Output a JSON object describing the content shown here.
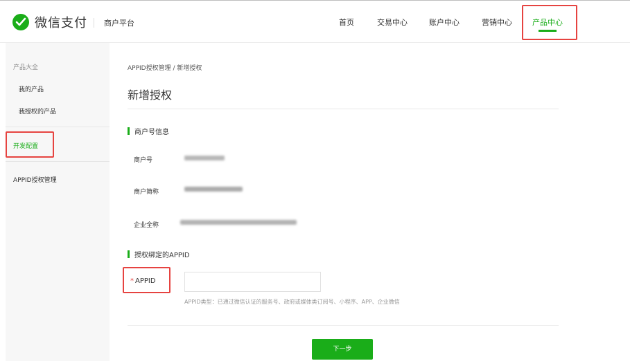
{
  "header": {
    "brand": "微信支付",
    "platform": "商户平台",
    "nav": [
      {
        "label": "首页"
      },
      {
        "label": "交易中心"
      },
      {
        "label": "账户中心"
      },
      {
        "label": "营销中心"
      },
      {
        "label": "产品中心",
        "active": true
      }
    ]
  },
  "sidebar": {
    "group_title": "产品大全",
    "items": [
      {
        "label": "我的产品"
      },
      {
        "label": "我授权的产品"
      },
      {
        "label": "开发配置",
        "active": true
      },
      {
        "label": "APPID授权管理"
      }
    ]
  },
  "main": {
    "breadcrumb": "APPID授权管理 / 新增授权",
    "title": "新增授权",
    "merchant_section": {
      "heading": "商户号信息",
      "fields": [
        {
          "label": "商户号"
        },
        {
          "label": "商户简称"
        },
        {
          "label": "企业全称"
        }
      ]
    },
    "appid_section": {
      "heading": "授权绑定的APPID",
      "required_mark": "*",
      "label": "APPID",
      "input_value": "",
      "hint": "APPID类型：已通过微信认证的服务号、政府或媒体类订阅号、小程序、APP、企业微信"
    },
    "next_button": "下一步"
  },
  "colors": {
    "brand_green": "#1aad19",
    "highlight_red": "#e64340",
    "sidebar_bg": "#f7f7f7"
  }
}
